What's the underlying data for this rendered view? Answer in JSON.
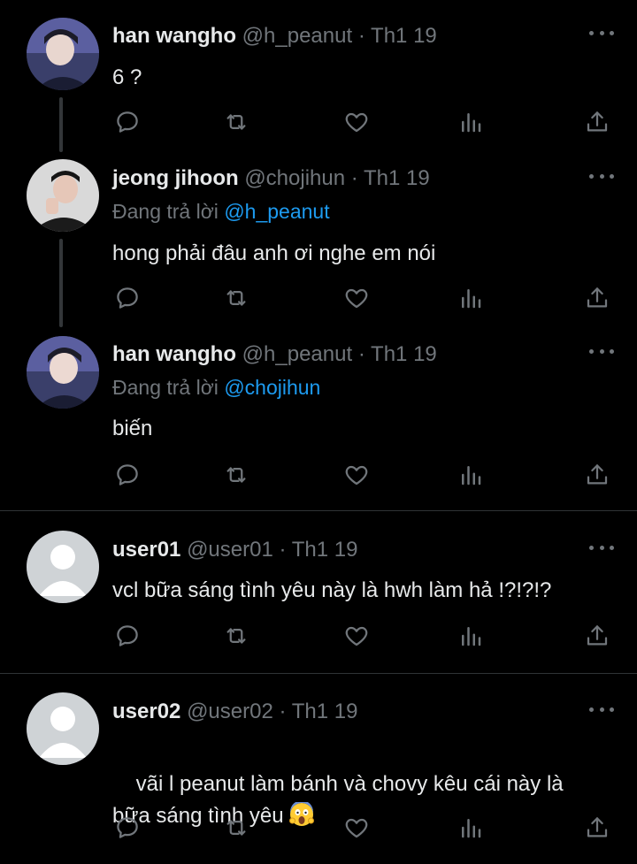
{
  "colors": {
    "background": "#000000",
    "text_primary": "#e7e9ea",
    "text_secondary": "#71767b",
    "link": "#1d9bf0",
    "separator": "#2f3336"
  },
  "action_icons": [
    "reply-icon",
    "retweet-icon",
    "like-icon",
    "views-icon",
    "share-icon"
  ],
  "tweets": [
    {
      "name": "han wangho",
      "handle": "@h_peanut",
      "dot": "·",
      "date": "Th1 19",
      "reply_prefix": "",
      "reply_to": "",
      "text": "6 ?",
      "avatar": "photo"
    },
    {
      "name": "jeong jihoon",
      "handle": "@chojihun",
      "dot": "·",
      "date": "Th1 19",
      "reply_prefix": "Đang trả lời",
      "reply_to": "@h_peanut",
      "text": "hong phải đâu anh ơi nghe em nói",
      "avatar": "photo"
    },
    {
      "name": "han wangho",
      "handle": "@h_peanut",
      "dot": "·",
      "date": "Th1 19",
      "reply_prefix": "Đang trả lời",
      "reply_to": "@chojihun",
      "text": "biến",
      "avatar": "photo"
    },
    {
      "name": "user01",
      "handle": "@user01",
      "dot": "·",
      "date": "Th1 19",
      "reply_prefix": "",
      "reply_to": "",
      "text": "vcl bữa sáng tình yêu này là hwh làm hả !?!?!?",
      "avatar": "default"
    },
    {
      "name": "user02",
      "handle": "@user02",
      "dot": "·",
      "date": "Th1 19",
      "reply_prefix": "",
      "reply_to": "",
      "text": "vãi l peanut làm bánh và chovy kêu cái này là",
      "text2": "bữa sáng tình yêu",
      "emoji": "screaming-face-emoji",
      "avatar": "default"
    }
  ]
}
